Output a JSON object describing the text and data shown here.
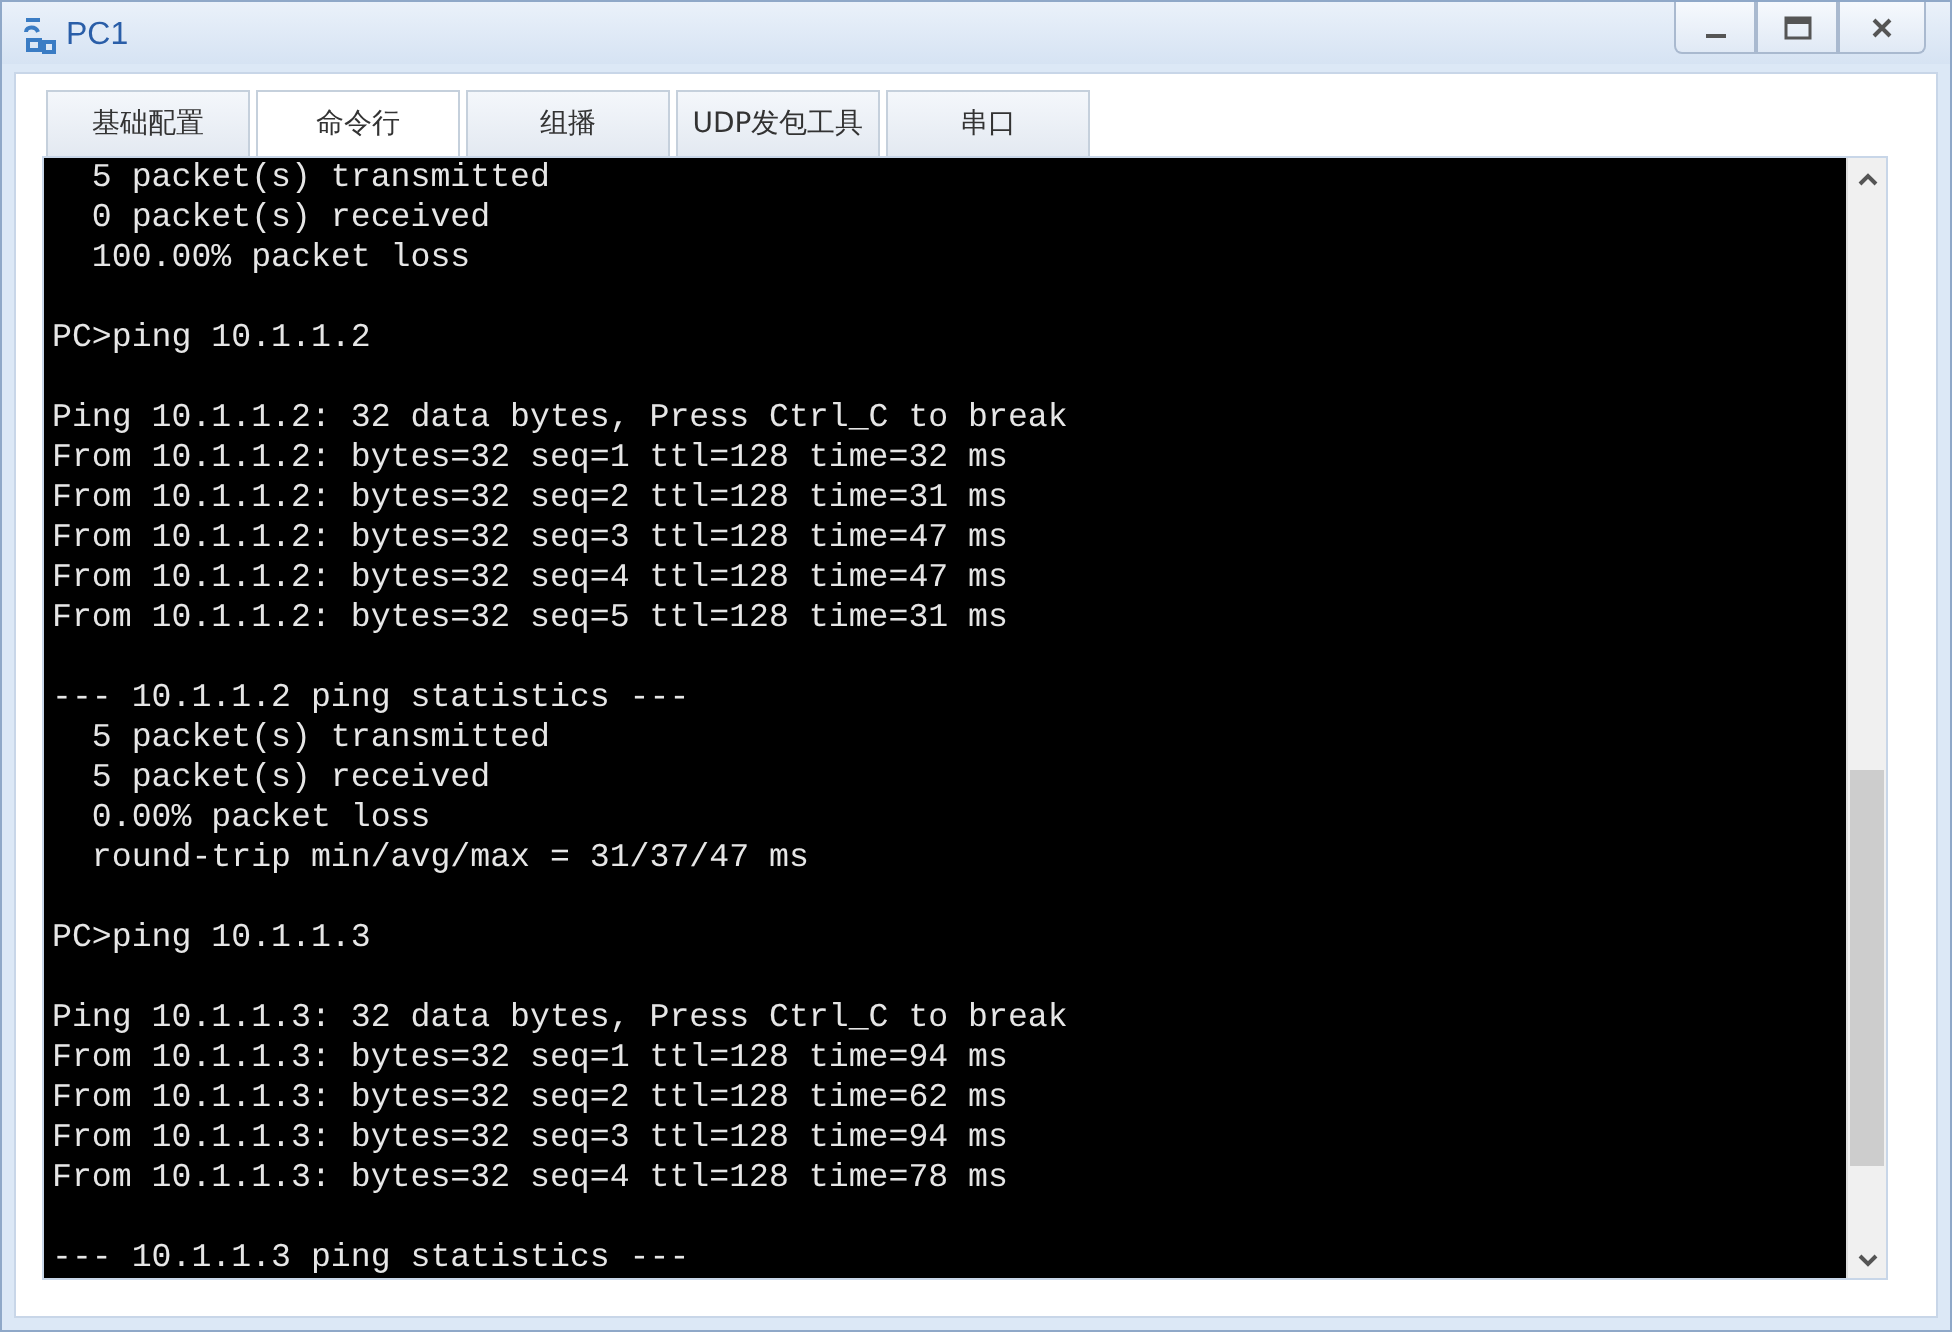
{
  "window": {
    "title": "PC1"
  },
  "tabs": [
    {
      "label": "基础配置",
      "selected": false
    },
    {
      "label": "命令行",
      "selected": true
    },
    {
      "label": "组播",
      "selected": false
    },
    {
      "label": "UDP发包工具",
      "selected": false
    },
    {
      "label": "串口",
      "selected": false
    }
  ],
  "terminal": {
    "lines": [
      {
        "kind": "text",
        "text": "  5 packet(s) transmitted"
      },
      {
        "kind": "text",
        "text": "  0 packet(s) received"
      },
      {
        "kind": "text",
        "text": "  100.00% packet loss"
      },
      {
        "kind": "blank"
      },
      {
        "kind": "text",
        "text": "PC>ping 10.1.1.2"
      },
      {
        "kind": "blank"
      },
      {
        "kind": "text",
        "text": "Ping 10.1.1.2: 32 data bytes, Press Ctrl_C to break"
      },
      {
        "kind": "text",
        "text": "From 10.1.1.2: bytes=32 seq=1 ttl=128 time=32 ms"
      },
      {
        "kind": "text",
        "text": "From 10.1.1.2: bytes=32 seq=2 ttl=128 time=31 ms"
      },
      {
        "kind": "text",
        "text": "From 10.1.1.2: bytes=32 seq=3 ttl=128 time=47 ms"
      },
      {
        "kind": "text",
        "text": "From 10.1.1.2: bytes=32 seq=4 ttl=128 time=47 ms"
      },
      {
        "kind": "text",
        "text": "From 10.1.1.2: bytes=32 seq=5 ttl=128 time=31 ms"
      },
      {
        "kind": "blank"
      },
      {
        "kind": "text",
        "text": "--- 10.1.1.2 ping statistics ---"
      },
      {
        "kind": "text",
        "text": "  5 packet(s) transmitted"
      },
      {
        "kind": "text",
        "text": "  5 packet(s) received"
      },
      {
        "kind": "text",
        "text": "  0.00% packet loss"
      },
      {
        "kind": "text",
        "text": "  round-trip min/avg/max = 31/37/47 ms"
      },
      {
        "kind": "blank"
      },
      {
        "kind": "text",
        "text": "PC>ping 10.1.1.3"
      },
      {
        "kind": "blank"
      },
      {
        "kind": "text",
        "text": "Ping 10.1.1.3: 32 data bytes, Press Ctrl_C to break"
      },
      {
        "kind": "text",
        "text": "From 10.1.1.3: bytes=32 seq=1 ttl=128 time=94 ms"
      },
      {
        "kind": "text",
        "text": "From 10.1.1.3: bytes=32 seq=2 ttl=128 time=62 ms"
      },
      {
        "kind": "text",
        "text": "From 10.1.1.3: bytes=32 seq=3 ttl=128 time=94 ms"
      },
      {
        "kind": "text",
        "text": "From 10.1.1.3: bytes=32 seq=4 ttl=128 time=78 ms"
      },
      {
        "kind": "blank"
      },
      {
        "kind": "text",
        "text": "--- 10.1.1.3 ping statistics ---"
      }
    ]
  }
}
